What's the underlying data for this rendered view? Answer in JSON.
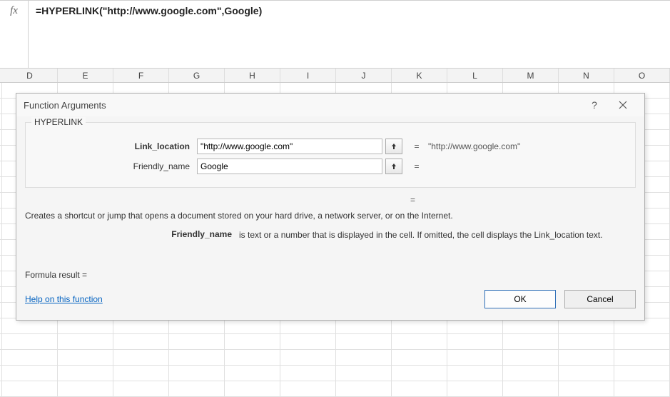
{
  "formula_bar": {
    "fx_label": "fx",
    "text": "=HYPERLINK(\"http://www.google.com\",Google)"
  },
  "columns": [
    "D",
    "E",
    "F",
    "G",
    "H",
    "I",
    "J",
    "K",
    "L",
    "M",
    "N",
    "O"
  ],
  "dialog": {
    "title": "Function Arguments",
    "help_tip": "?",
    "fieldset_label": "HYPERLINK",
    "args": [
      {
        "label": "Link_location",
        "bold": true,
        "value": "\"http://www.google.com\"",
        "result": "\"http://www.google.com\""
      },
      {
        "label": "Friendly_name",
        "bold": false,
        "value": "Google",
        "result": ""
      }
    ],
    "eq_symbol": "=",
    "overall_result": "=",
    "func_description": "Creates a shortcut or jump that opens a document stored on your hard drive, a network server, or on the Internet.",
    "arg_help_label": "Friendly_name",
    "arg_help_text": "is text or a number that is displayed in the cell. If omitted, the cell displays the Link_location text.",
    "formula_result_label": "Formula result =",
    "formula_result_value": "",
    "help_link": "Help on this function",
    "ok_label": "OK",
    "cancel_label": "Cancel"
  }
}
